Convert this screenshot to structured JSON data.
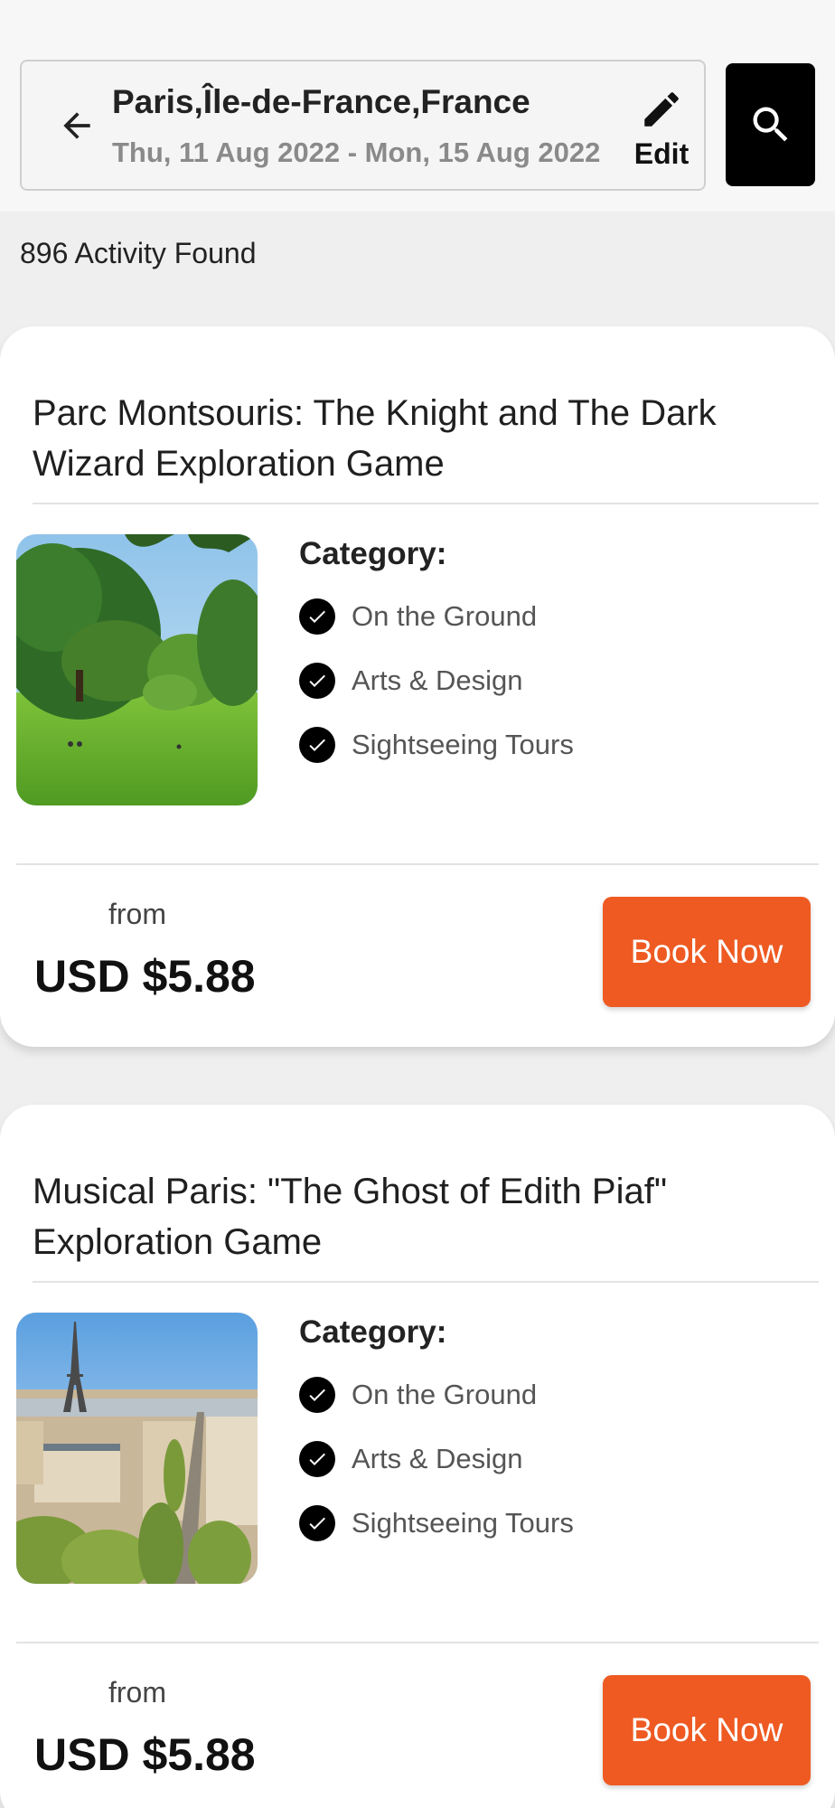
{
  "header": {
    "location": "Paris,Île-de-France,France",
    "dates": "Thu, 11 Aug 2022 - Mon, 15 Aug 2022",
    "edit_label": "Edit",
    "icons": {
      "back": "arrow-left-icon",
      "edit": "pencil-icon",
      "search": "search-icon"
    }
  },
  "results": {
    "count_text": "896 Activity Found"
  },
  "activities": [
    {
      "title": "Parc Montsouris: The Knight and The Dark Wizard Exploration Game",
      "image": "park-photo",
      "category_heading": "Category:",
      "categories": [
        "On the Ground",
        "Arts & Design",
        "Sightseeing Tours"
      ],
      "from_label": "from",
      "price": "USD $5.88",
      "book_label": "Book Now"
    },
    {
      "title": "Musical Paris: \"The Ghost of Edith Piaf\" Exploration Game",
      "image": "paris-eiffel-tower-photo",
      "category_heading": "Category:",
      "categories": [
        "On the Ground",
        "Arts & Design",
        "Sightseeing Tours"
      ],
      "from_label": "from",
      "price": "USD $5.88",
      "book_label": "Book Now"
    }
  ],
  "colors": {
    "accent": "#ee5a22",
    "search_button": "#000000",
    "page_background": "#efefef"
  }
}
